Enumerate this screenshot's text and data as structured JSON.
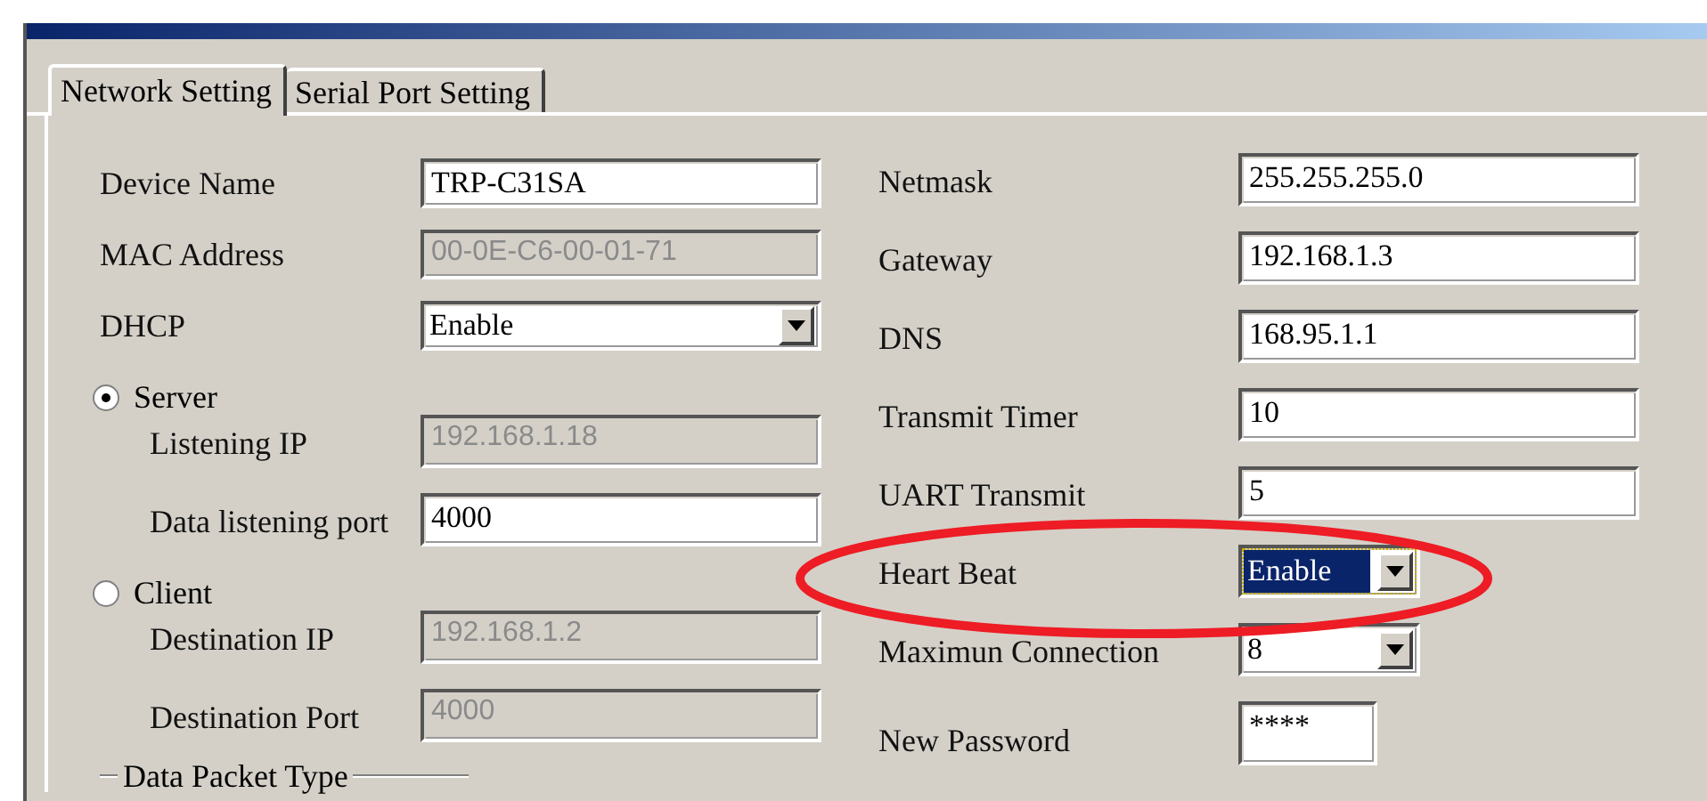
{
  "tabs": [
    {
      "label": "Network Setting",
      "selected": true
    },
    {
      "label": "Serial Port Setting",
      "selected": false
    }
  ],
  "left": [
    {
      "kind": "text",
      "label": "Device Name",
      "value": "TRP-C31SA",
      "disabled": false
    },
    {
      "kind": "text",
      "label": "MAC Address",
      "value": "00-0E-C6-00-01-71",
      "disabled": true
    },
    {
      "kind": "select",
      "label": "DHCP",
      "value": "Enable",
      "disabled": false
    },
    {
      "kind": "radio",
      "label": "Server",
      "selected": true,
      "children": [
        {
          "kind": "text",
          "label": "Listening IP",
          "value": "192.168.1.18",
          "disabled": true
        },
        {
          "kind": "text",
          "label": "Data listening port",
          "value": "4000",
          "disabled": false
        }
      ]
    },
    {
      "kind": "radio",
      "label": "Client",
      "selected": false,
      "children": [
        {
          "kind": "text",
          "label": "Destination IP",
          "value": "192.168.1.2",
          "disabled": true
        },
        {
          "kind": "text",
          "label": "Destination Port",
          "value": "4000",
          "disabled": true
        }
      ]
    },
    {
      "kind": "group",
      "label": "Data Packet Type"
    }
  ],
  "right": [
    {
      "kind": "text",
      "label": "Netmask",
      "value": "255.255.255.0"
    },
    {
      "kind": "text",
      "label": "Gateway",
      "value": "192.168.1.3"
    },
    {
      "kind": "text",
      "label": "DNS",
      "value": "168.95.1.1"
    },
    {
      "kind": "text",
      "label": "Transmit Timer",
      "value": "10"
    },
    {
      "kind": "text",
      "label": "UART Transmit",
      "value": "5"
    },
    {
      "kind": "select",
      "label": "Heart Beat",
      "value": "Enable",
      "focused": true
    },
    {
      "kind": "select",
      "label": "Maximun Connection",
      "value": "8",
      "focused": false
    },
    {
      "kind": "password",
      "label": "New Password",
      "value": "****"
    }
  ],
  "annotations": [
    {
      "kind": "ellipse"
    }
  ]
}
